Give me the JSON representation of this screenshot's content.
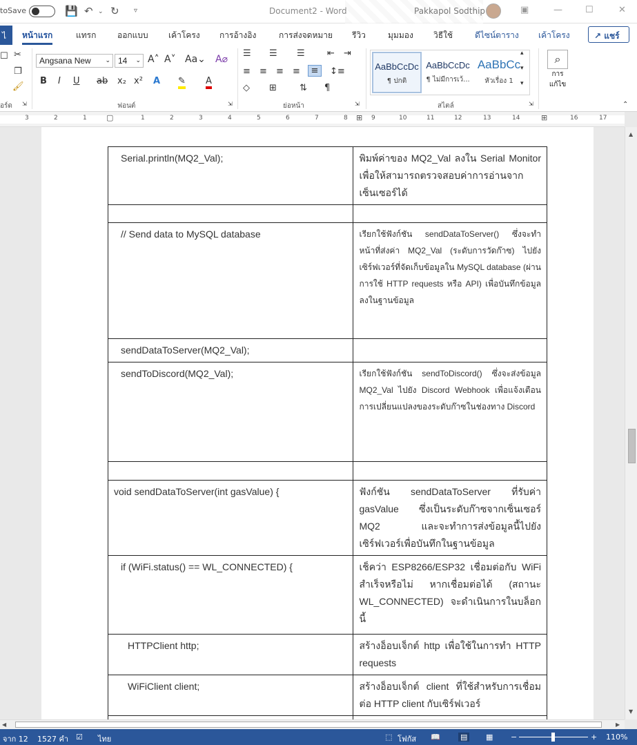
{
  "titlebar": {
    "autosave": "toSave",
    "doc_title": "Document2  -  Word",
    "user": "Pakkapol Sodthip"
  },
  "tabs": {
    "file": "ไ",
    "items": [
      "หน้าแรก",
      "แทรก",
      "ออกแบบ",
      "เค้าโครง",
      "การอ้างอิง",
      "การส่งจดหมาย",
      "รีวิว",
      "มุมมอง",
      "วิธีใช้",
      "ดีไซน์ตาราง",
      "เค้าโครง"
    ],
    "share": "แชร์"
  },
  "ribbon": {
    "font_name": "Angsana New",
    "font_size": "14",
    "font_group": "ฟอนต์",
    "paragraph_group": "ย่อหน้า",
    "styles_group": "สไตล์",
    "clipboard_group": "อร์ด",
    "styles": [
      {
        "sample": "AaBbCcDc",
        "name": "¶ ปกติ"
      },
      {
        "sample": "AaBbCcDc",
        "name": "¶ ไม่มีการเว้..."
      },
      {
        "sample": "AaBbCc",
        "name": "หัวเรื่อง 1"
      }
    ],
    "find_label": "การ",
    "find_label2": "แก้ไข"
  },
  "ruler": {
    "numbers": [
      "3",
      "2",
      "1",
      "1",
      "2",
      "3",
      "4",
      "5",
      "6",
      "7",
      "8",
      "9",
      "10",
      "11",
      "12",
      "13",
      "14",
      "15",
      "16",
      "17"
    ]
  },
  "table": {
    "rows": [
      {
        "c1": "Serial.println(MQ2_Val);",
        "c2": "พิมพ์ค่าของ MQ2_Val ลงใน Serial Monitor เพื่อให้สามารถตรวจสอบค่าการอ่านจากเซ็นเซอร์ได้",
        "ind": "",
        "small": false,
        "h": 81
      },
      {
        "c1": "",
        "c2": "",
        "ind": "",
        "small": false,
        "h": 26
      },
      {
        "c1": "// Send data to MySQL database",
        "c2": "เรียกใช้ฟังก์ชัน sendDataToServer() ซึ่งจะทำหน้าที่ส่งค่า MQ2_Val (ระดับการวัดก๊าซ) ไปยังเซิร์ฟเวอร์ที่จัดเก็บข้อมูลใน MySQL database (ผ่านการใช้ HTTP requests หรือ API) เพื่อบันทึกข้อมูลลงในฐานข้อมูล",
        "ind": "",
        "small": true,
        "h": 168
      },
      {
        "c1": "sendDataToServer(MQ2_Val);",
        "c2": "",
        "ind": "",
        "small": false,
        "h": 27
      },
      {
        "c1": "sendToDiscord(MQ2_Val);",
        "c2": "เรียกใช้ฟังก์ชัน sendToDiscord() ซึ่งจะส่งข้อมูล MQ2_Val ไปยัง Discord Webhook เพื่อแจ้งเตือนการเปลี่ยนแปลงของระดับก๊าซในช่องทาง Discord",
        "ind": "",
        "small": true,
        "h": 144
      },
      {
        "c1": "",
        "c2": "",
        "ind": "",
        "small": false,
        "h": 27
      },
      {
        "c1": "void sendDataToServer(int gasValue) {",
        "c2": "ฟังก์ชัน sendDataToServer ที่รับค่า gasValue ซึ่งเป็นระดับก๊าซจากเซ็นเซอร์ MQ2 และจะทำการส่งข้อมูลนี้ไปยังเซิร์ฟเวอร์เพื่อบันทึกในฐานข้อมูล",
        "ind": "ind0",
        "small": false,
        "h": 108
      },
      {
        "c1": "if (WiFi.status() == WL_CONNECTED) {",
        "c2": "เช็คว่า ESP8266/ESP32 เชื่อมต่อกับ WiFi สำเร็จหรือไม่ หากเชื่อมต่อได้ (สถานะ WL_CONNECTED) จะดำเนินการในบล็อกนี้",
        "ind": "",
        "small": false,
        "h": 114
      },
      {
        "c1": "HTTPClient http;",
        "c2": "สร้างอ็อบเจ็กต์ http เพื่อใช้ในการทำ HTTP requests",
        "ind": "ind2",
        "small": false,
        "h": 57
      },
      {
        "c1": "WiFiClient client;",
        "c2": "สร้างอ็อบเจ็กต์ client ที่ใช้สำหรับการเชื่อมต่อ HTTP client กับเซิร์ฟเวอร์",
        "ind": "ind2",
        "small": false,
        "h": 58
      },
      {
        "c1": "",
        "c2": "",
        "ind": "",
        "small": false,
        "h": 30
      }
    ]
  },
  "status": {
    "page": "จาก 12",
    "words": "1527 คำ",
    "lang": "ไทย",
    "focus": "โฟกัส",
    "zoom": "110%"
  }
}
